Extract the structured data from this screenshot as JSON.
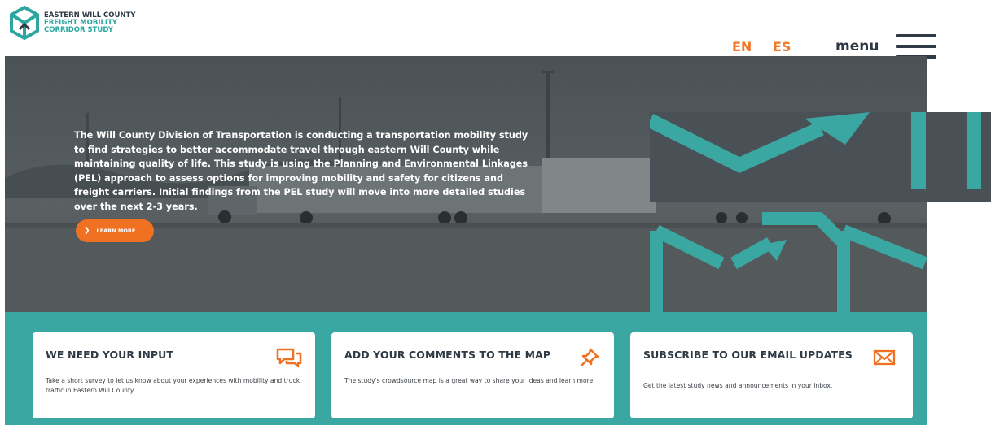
{
  "logo": {
    "line1": "EASTERN WILL COUNTY",
    "line2": "FREIGHT MOBILITY",
    "line3": "CORRIDOR STUDY"
  },
  "nav": {
    "lang_en": "EN",
    "lang_es": "ES",
    "menu_label": "menu"
  },
  "hero": {
    "description": "The Will County Division of Transportation is conducting a transportation mobility study to find strategies to better accommodate travel through eastern Will County while maintaining quality of life. This study is using the Planning and Environmental Linkages (PEL) approach to assess options for improving mobility and safety for citizens and freight carriers. Initial findings from the PEL study will move into more detailed studies over the next 2-3 years.",
    "cta_label": "LEARN MORE"
  },
  "cards": [
    {
      "title": "WE NEED YOUR INPUT",
      "text": "Take a short survey to let us know about your experiences with mobility and truck traffic in Eastern Will County.",
      "icon": "chat-bubbles-icon"
    },
    {
      "title": "ADD YOUR COMMENTS TO THE MAP",
      "text": "The study's crowdsource map is a great way to share your ideas and learn more.",
      "icon": "pushpin-icon"
    },
    {
      "title": "SUBSCRIBE TO OUR EMAIL UPDATES",
      "text": "Get the latest study news and announcements in your inbox.",
      "icon": "envelope-icon"
    }
  ],
  "colors": {
    "teal": "#3aa7a2",
    "orange": "#f07122",
    "dark": "#2f3a44"
  }
}
